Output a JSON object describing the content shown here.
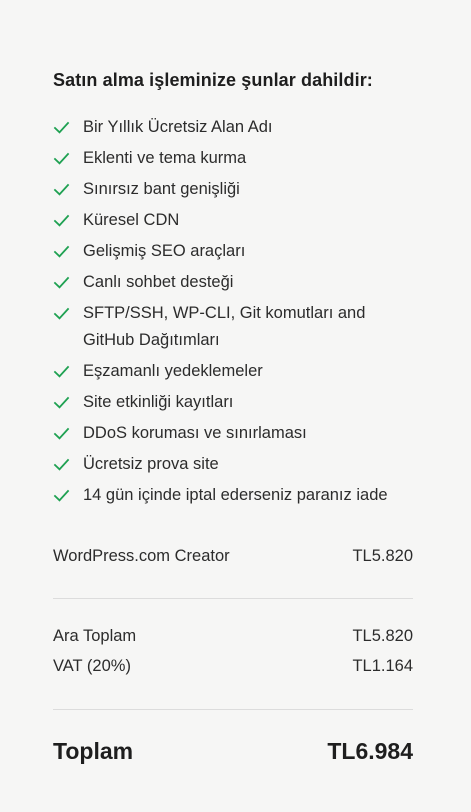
{
  "heading": "Satın alma işleminize şunlar dahildir:",
  "features": [
    {
      "label": "Bir Yıllık Ücretsiz Alan Adı",
      "icon": "check-icon"
    },
    {
      "label": "Eklenti ve tema kurma",
      "icon": "check-icon"
    },
    {
      "label": "Sınırsız bant genişliği",
      "icon": "check-icon"
    },
    {
      "label": "Küresel CDN",
      "icon": "check-icon"
    },
    {
      "label": "Gelişmiş SEO araçları",
      "icon": "check-icon"
    },
    {
      "label": "Canlı sohbet desteği",
      "icon": "check-icon"
    },
    {
      "label": "SFTP/SSH, WP-CLI, Git komutları and GitHub Dağıtımları",
      "icon": "check-icon"
    },
    {
      "label": "Eşzamanlı yedeklemeler",
      "icon": "check-icon"
    },
    {
      "label": "Site etkinliği kayıtları",
      "icon": "check-icon"
    },
    {
      "label": "DDoS koruması ve sınırlaması",
      "icon": "check-icon"
    },
    {
      "label": "Ücretsiz prova site",
      "icon": "check-icon"
    },
    {
      "label": "14 gün içinde iptal ederseniz paranız iade",
      "icon": "check-icon"
    }
  ],
  "product": {
    "name": "WordPress.com Creator",
    "price": "TL5.820"
  },
  "subtotal": {
    "label": "Ara Toplam",
    "value": "TL5.820"
  },
  "vat": {
    "label": "VAT (20%)",
    "value": "TL1.164"
  },
  "total": {
    "label": "Toplam",
    "value": "TL6.984"
  },
  "colors": {
    "check": "#1fa152",
    "background": "#f6f6f5",
    "divider": "#dcdcdc",
    "text": "#1e1e1e"
  }
}
